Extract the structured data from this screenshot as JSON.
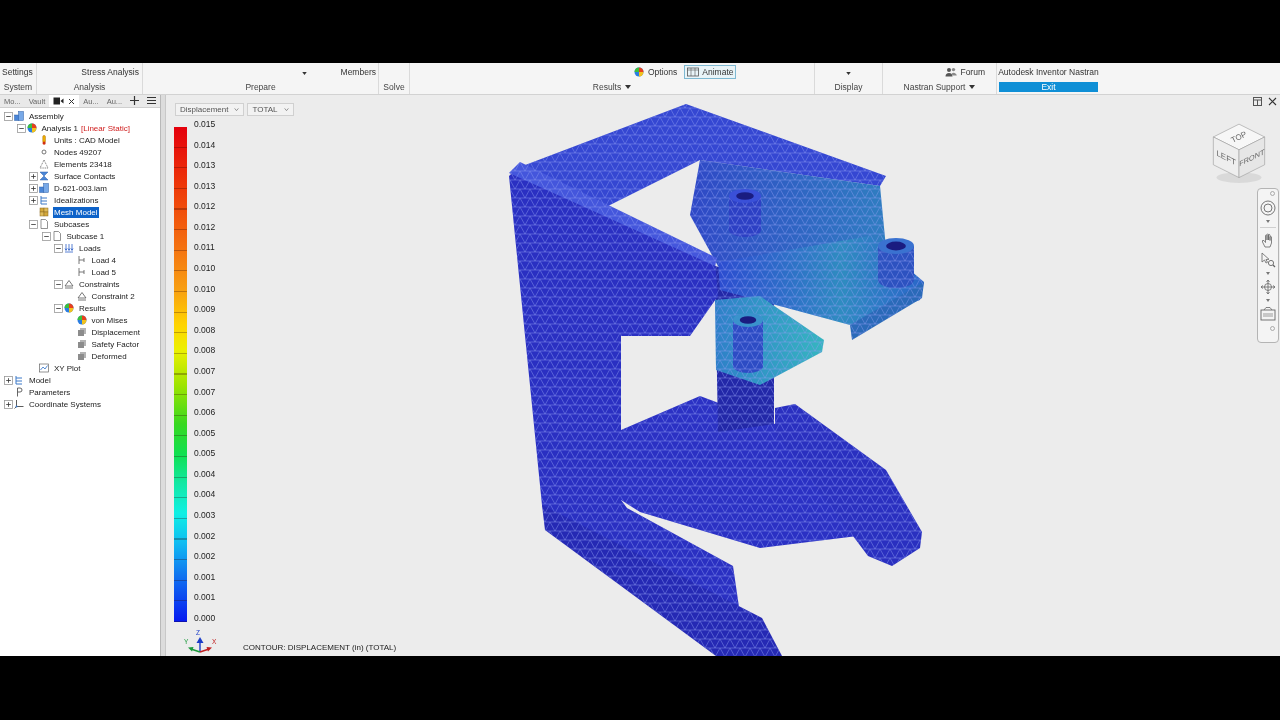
{
  "ribbon": {
    "groups": [
      {
        "label": "System",
        "menu": false,
        "highlighted": false,
        "items": [
          {
            "kind": "text",
            "label": "Settings"
          }
        ]
      },
      {
        "label": "Analysis",
        "menu": false,
        "highlighted": false,
        "items": [
          {
            "kind": "text",
            "label": "Stress Analysis"
          }
        ]
      },
      {
        "label": "Prepare",
        "menu": false,
        "highlighted": false,
        "items": [
          {
            "kind": "caret"
          },
          {
            "kind": "text",
            "label": "Members"
          }
        ]
      },
      {
        "label": "Solve",
        "menu": false,
        "highlighted": false
      },
      {
        "label": "Results",
        "menu": true,
        "highlighted": false,
        "items": [
          {
            "kind": "contour",
            "label": "Options",
            "selected": false
          },
          {
            "kind": "film",
            "label": "Animate",
            "selected": true
          }
        ]
      },
      {
        "label": "Display",
        "menu": false,
        "highlighted": false,
        "items": [
          {
            "kind": "caret"
          }
        ]
      },
      {
        "label": "Nastran Support",
        "menu": true,
        "highlighted": false,
        "items": [
          {
            "kind": "people",
            "label": "Forum"
          }
        ]
      },
      {
        "label": "Exit",
        "menu": false,
        "highlighted": true,
        "items": [
          {
            "kind": "text",
            "label": "Autodesk Inventor Nastran"
          }
        ]
      }
    ]
  },
  "panel": {
    "tabs": [
      {
        "kind": "text",
        "label": "Mo...",
        "selected": false
      },
      {
        "kind": "text",
        "label": "Vault",
        "selected": false
      },
      {
        "kind": "block",
        "selected": true
      },
      {
        "kind": "text",
        "label": "Au...",
        "selected": false
      },
      {
        "kind": "text",
        "label": "Au...",
        "selected": false
      }
    ],
    "tree": [
      {
        "kind": "assembly",
        "label": "Assembly",
        "expanded": true,
        "selected": false,
        "children": [
          {
            "kind": "analysis",
            "label": "Analysis 1",
            "tag": "[Linear Static]",
            "expanded": true,
            "selected": false,
            "children": [
              {
                "kind": "thermometer",
                "label": "Units : CAD Model",
                "selected": false
              },
              {
                "kind": "node",
                "label": "Nodes 49207",
                "selected": false
              },
              {
                "kind": "element",
                "label": "Elements 23418",
                "selected": false
              },
              {
                "kind": "contact",
                "label": "Surface Contacts",
                "expanded": false,
                "selected": false
              },
              {
                "kind": "assembly",
                "label": "D-621-003.iam",
                "expanded": false,
                "selected": false
              },
              {
                "kind": "list",
                "label": "Idealizations",
                "expanded": false,
                "selected": false
              },
              {
                "kind": "mesh",
                "label": "Mesh Model",
                "selected": true
              },
              {
                "kind": "page",
                "label": "Subcases",
                "expanded": true,
                "selected": false,
                "children": [
                  {
                    "kind": "page",
                    "label": "Subcase 1",
                    "expanded": true,
                    "selected": false,
                    "children": [
                      {
                        "kind": "loads",
                        "label": "Loads",
                        "expanded": true,
                        "selected": false,
                        "children": [
                          {
                            "kind": "load",
                            "label": "Load 4",
                            "selected": false
                          },
                          {
                            "kind": "load",
                            "label": "Load 5",
                            "selected": false
                          }
                        ]
                      },
                      {
                        "kind": "constraint",
                        "label": "Constraints",
                        "expanded": true,
                        "selected": false,
                        "children": [
                          {
                            "kind": "constraint",
                            "label": "Constraint 2",
                            "selected": false
                          }
                        ]
                      },
                      {
                        "kind": "contour",
                        "label": "Results",
                        "expanded": true,
                        "selected": false,
                        "children": [
                          {
                            "kind": "contour",
                            "label": "von Mises",
                            "selected": false
                          },
                          {
                            "kind": "result",
                            "label": "Displacement",
                            "selected": false
                          },
                          {
                            "kind": "result",
                            "label": "Safety Factor",
                            "selected": false
                          },
                          {
                            "kind": "result",
                            "label": "Deformed",
                            "selected": false
                          }
                        ]
                      }
                    ]
                  }
                ]
              },
              {
                "kind": "plot",
                "label": "XY Plot",
                "selected": false
              }
            ]
          }
        ]
      },
      {
        "kind": "list",
        "label": "Model",
        "expanded": false,
        "selected": false
      },
      {
        "kind": "parameter",
        "label": "Parameters",
        "selected": false
      },
      {
        "kind": "axes",
        "label": "Coordinate Systems",
        "expanded": false,
        "selected": false
      }
    ]
  },
  "viewport": {
    "result_type": "Displacement",
    "component": "TOTAL",
    "legend": [
      "0.015",
      "0.014",
      "0.013",
      "0.013",
      "0.012",
      "0.012",
      "0.011",
      "0.010",
      "0.010",
      "0.009",
      "0.008",
      "0.008",
      "0.007",
      "0.007",
      "0.006",
      "0.005",
      "0.005",
      "0.004",
      "0.004",
      "0.003",
      "0.002",
      "0.002",
      "0.001",
      "0.001",
      "0.000"
    ],
    "triad": [
      "Z",
      "Y",
      "X"
    ],
    "caption": "CONTOUR: DISPLACEMENT (in) (TOTAL)",
    "view_cube": [
      "TOP",
      "LEFT",
      "FRONT"
    ]
  }
}
